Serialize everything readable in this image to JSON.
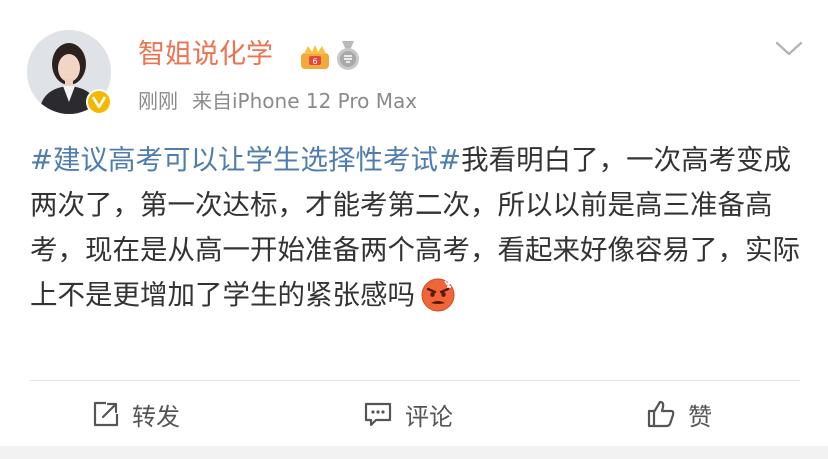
{
  "post": {
    "username": "智姐说化学",
    "timestamp": "刚刚",
    "source": "来自iPhone 12 Pro Max",
    "hashtag": "#建议高考可以让学生选择性考试#",
    "body": "我看明白了，一次高考变成两次了，第一次达标，才能考第二次，所以以前是高三准备高考，现在是从高一开始准备两个高考，看起来好像容易了，实际上不是更增加了学生的紧张感吗"
  },
  "actions": {
    "repost_label": "转发",
    "comment_label": "评论",
    "like_label": "赞"
  },
  "colors": {
    "username": "#eb7350",
    "hashtag": "#507daf",
    "body_text": "#333333",
    "meta_text": "#8a8a8a",
    "verified_badge": "#f5b800"
  },
  "icons": {
    "verified": "verified-v-icon",
    "member_crown": "crown-badge-icon",
    "medal": "medal-badge-icon",
    "more": "chevron-down-icon",
    "emoji": "angry-face-emoji",
    "repost": "repost-icon",
    "comment": "comment-icon",
    "like": "thumbs-up-icon"
  }
}
